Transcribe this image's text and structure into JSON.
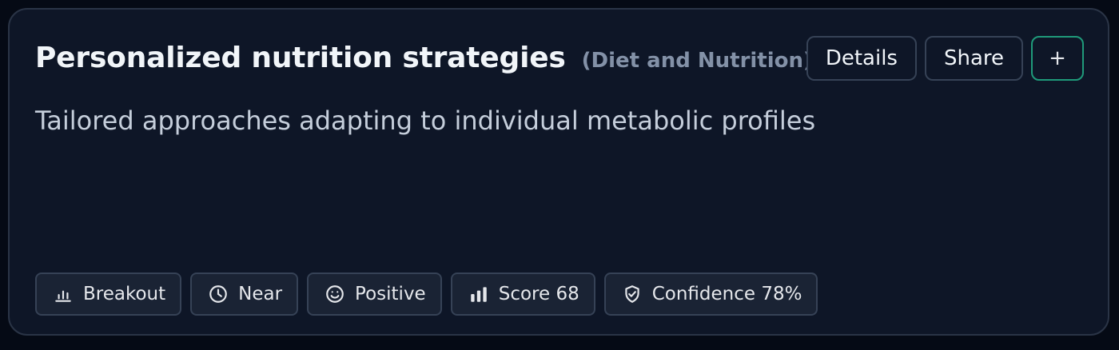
{
  "card": {
    "title": "Personalized nutrition strategies",
    "category": "(Diet and Nutrition)",
    "description": "Tailored approaches adapting to individual metabolic profiles"
  },
  "actions": {
    "details_label": "Details",
    "share_label": "Share",
    "add_label": "+"
  },
  "tags": [
    {
      "label": "Breakout",
      "icon": "bar-chart-icon"
    },
    {
      "label": "Near",
      "icon": "clock-icon"
    },
    {
      "label": "Positive",
      "icon": "smile-icon"
    },
    {
      "label": "Score 68",
      "icon": "signal-bars-icon"
    },
    {
      "label": "Confidence 78%",
      "icon": "shield-check-icon"
    }
  ],
  "colors": {
    "background": "#050a15",
    "card": "#0e1627",
    "accent": "#1f9a7a"
  }
}
